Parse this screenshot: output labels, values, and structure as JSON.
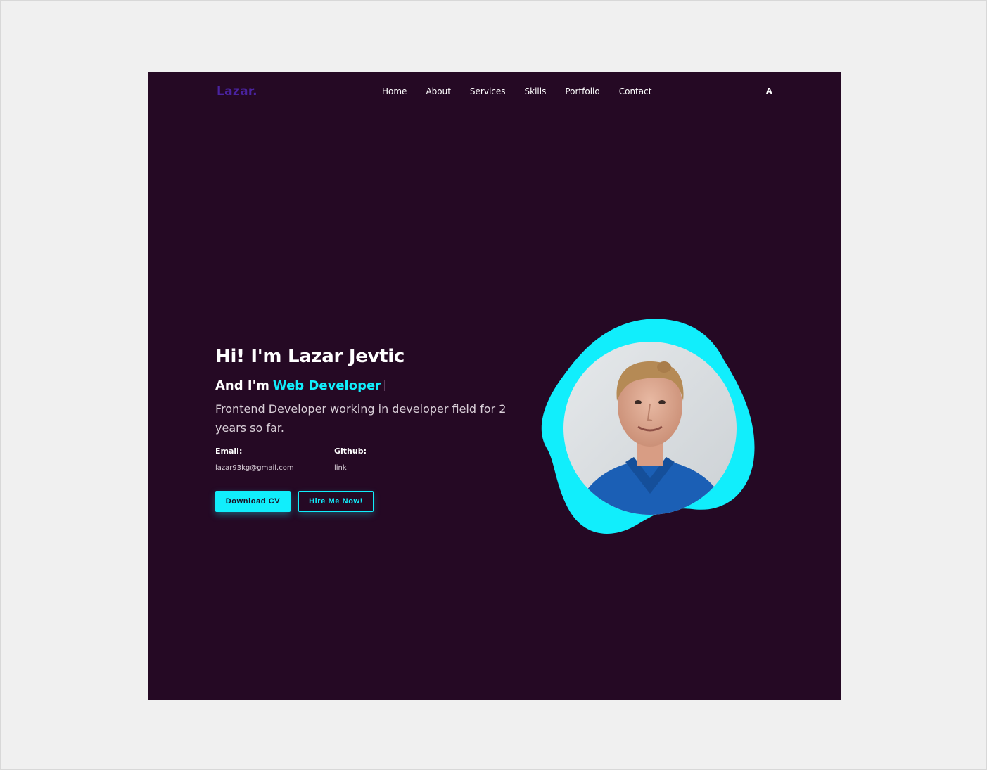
{
  "nav": {
    "logo": "Lazar.",
    "links": [
      "Home",
      "About",
      "Services",
      "Skills",
      "Portfolio",
      "Contact"
    ],
    "right_label": "A"
  },
  "hero": {
    "title": "Hi! I'm Lazar Jevtic",
    "subtitle_prefix": "And I'm",
    "role": "Web Developer",
    "description": "Frontend Developer working in developer field for 2 years so far.",
    "email_label": "Email:",
    "email_value": "lazar93kg@gmail.com",
    "github_label": "Github:",
    "github_value": "link",
    "download_button": "Download CV",
    "hire_button": "Hire Me Now!"
  },
  "colors": {
    "background": "#250924",
    "accent": "#11eefc",
    "logo": "#4a23a0"
  }
}
